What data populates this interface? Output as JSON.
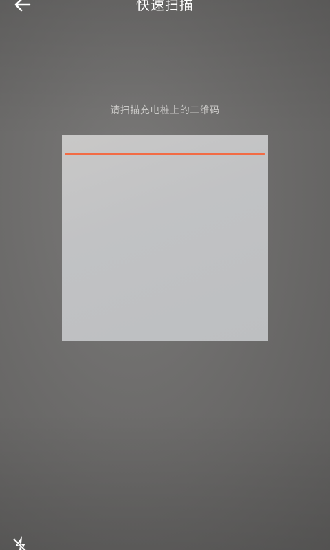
{
  "header": {
    "title": "快速扫描",
    "back_icon": "arrow-left-icon"
  },
  "scanner": {
    "hint": "请扫描充电桩上的二维码",
    "scan_line_color": "#f26b44"
  },
  "footer": {
    "flash_icon": "flash-off-icon"
  }
}
